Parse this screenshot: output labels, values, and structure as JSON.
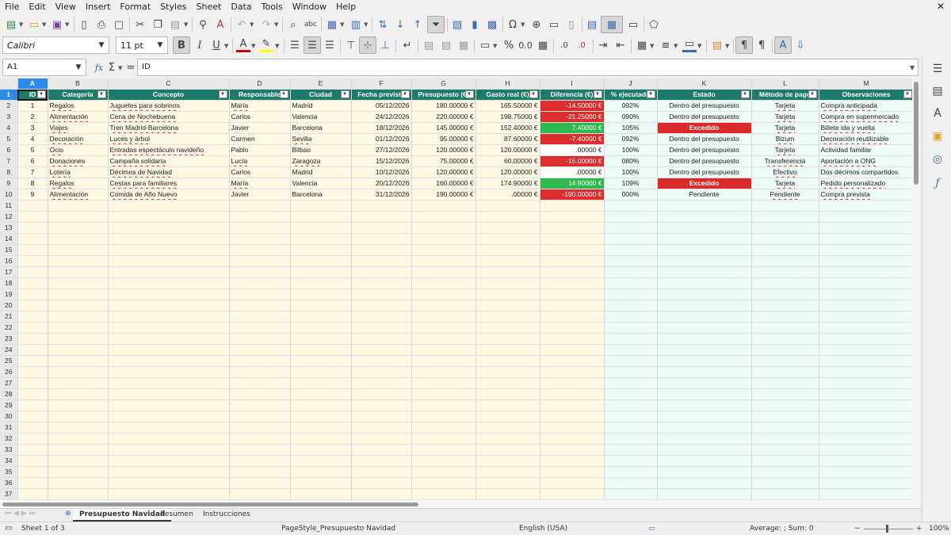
{
  "menu": [
    "File",
    "Edit",
    "View",
    "Insert",
    "Format",
    "Styles",
    "Sheet",
    "Data",
    "Tools",
    "Window",
    "Help"
  ],
  "font": {
    "name": "Calibri",
    "size": "11 pt"
  },
  "formula_bar": {
    "cell_ref": "A1",
    "content": "ID",
    "fx": "fx",
    "sigma": "Σ",
    "equals": "="
  },
  "columns": [
    "A",
    "B",
    "C",
    "D",
    "E",
    "F",
    "G",
    "H",
    "I",
    "J",
    "K",
    "L",
    "M"
  ],
  "headers": [
    "ID",
    "Categoría",
    "Concepto",
    "Responsable",
    "Ciudad",
    "Fecha prevista",
    "Presupuesto (€)",
    "Gasto real (€)",
    "Diferencia (€)",
    "% ejecutado",
    "Estado",
    "Método de pago",
    "Observaciones"
  ],
  "rows": [
    {
      "id": "1",
      "categoria": "Regalos",
      "concepto": "Juguetes para sobrinos",
      "responsable": "María",
      "ciudad": "Madrid",
      "fecha": "05/12/2026",
      "presupuesto": "180.00000 €",
      "gasto": "165.50000 €",
      "diferencia": "-14.50000 €",
      "diff_status": "red",
      "pct": "092%",
      "estado": "Dentro del presupuesto",
      "estado_status": "ok",
      "metodo": "Tarjeta",
      "observaciones": "Compra anticipada"
    },
    {
      "id": "2",
      "categoria": "Alimentación",
      "concepto": "Cena de Nochebuena",
      "responsable": "Carlos",
      "ciudad": "Valencia",
      "fecha": "24/12/2026",
      "presupuesto": "220.00000 €",
      "gasto": "198.75000 €",
      "diferencia": "-21.25000 €",
      "diff_status": "red",
      "pct": "090%",
      "estado": "Dentro del presupuesto",
      "estado_status": "ok",
      "metodo": "Tarjeta",
      "observaciones": "Compra en supermercado"
    },
    {
      "id": "3",
      "categoria": "Viajes",
      "concepto": "Tren Madrid-Barcelona",
      "responsable": "Javier",
      "ciudad": "Barcelona",
      "fecha": "18/12/2026",
      "presupuesto": "145.00000 €",
      "gasto": "152.40000 €",
      "diferencia": "7.40000 €",
      "diff_status": "green",
      "pct": "105%",
      "estado": "Excedido",
      "estado_status": "over",
      "metodo": "Tarjeta",
      "observaciones": "Billete ida y vuelta"
    },
    {
      "id": "4",
      "categoria": "Decoración",
      "concepto": "Luces y árbol",
      "responsable": "Carmen",
      "ciudad": "Sevilla",
      "fecha": "01/12/2026",
      "presupuesto": "95.00000 €",
      "gasto": "87.60000 €",
      "diferencia": "-7.40000 €",
      "diff_status": "red",
      "pct": "092%",
      "estado": "Dentro del presupuesto",
      "estado_status": "ok",
      "metodo": "Bizum",
      "observaciones": "Decoración reutilizable"
    },
    {
      "id": "5",
      "categoria": "Ocio",
      "concepto": "Entradas espectáculo navideño",
      "responsable": "Pablo",
      "ciudad": "Bilbao",
      "fecha": "27/12/2026",
      "presupuesto": "120.00000 €",
      "gasto": "120.00000 €",
      "diferencia": ".00000 €",
      "diff_status": "none",
      "pct": "100%",
      "estado": "Dentro del presupuesto",
      "estado_status": "ok",
      "metodo": "Tarjeta",
      "observaciones": "Actividad familiar"
    },
    {
      "id": "6",
      "categoria": "Donaciones",
      "concepto": "Campaña solidaria",
      "responsable": "Lucía",
      "ciudad": "Zaragoza",
      "fecha": "15/12/2026",
      "presupuesto": "75.00000 €",
      "gasto": "60.00000 €",
      "diferencia": "-15.00000 €",
      "diff_status": "red",
      "pct": "080%",
      "estado": "Dentro del presupuesto",
      "estado_status": "ok",
      "metodo": "Transferencia",
      "observaciones": "Aportación a ONG"
    },
    {
      "id": "7",
      "categoria": "Lotería",
      "concepto": "Décimos de Navidad",
      "responsable": "Carlos",
      "ciudad": "Madrid",
      "fecha": "10/12/2026",
      "presupuesto": "120.00000 €",
      "gasto": "120.00000 €",
      "diferencia": ".00000 €",
      "diff_status": "none",
      "pct": "100%",
      "estado": "Dentro del presupuesto",
      "estado_status": "ok",
      "metodo": "Efectivo",
      "observaciones": "Dos décimos compartidos"
    },
    {
      "id": "8",
      "categoria": "Regalos",
      "concepto": "Cestas para familiares",
      "responsable": "María",
      "ciudad": "Valencia",
      "fecha": "20/12/2026",
      "presupuesto": "160.00000 €",
      "gasto": "174.90000 €",
      "diferencia": "14.90000 €",
      "diff_status": "green",
      "pct": "109%",
      "estado": "Excedido",
      "estado_status": "over",
      "metodo": "Tarjeta",
      "observaciones": "Pedido personalizado"
    },
    {
      "id": "9",
      "categoria": "Alimentación",
      "concepto": "Comida de Año Nuevo",
      "responsable": "Javier",
      "ciudad": "Barcelona",
      "fecha": "31/12/2026",
      "presupuesto": "190.00000 €",
      "gasto": ".00000 €",
      "diferencia": "-190.00000 €",
      "diff_status": "red",
      "pct": "000%",
      "estado": "Pendiente",
      "estado_status": "pending",
      "metodo": "Pendiente",
      "observaciones": "Compra prevista"
    }
  ],
  "empty_row_numbers": [
    "11",
    "12",
    "13",
    "14",
    "15",
    "16",
    "17",
    "18",
    "19",
    "20",
    "21",
    "22",
    "23",
    "24",
    "25",
    "26",
    "27",
    "28",
    "29",
    "30",
    "31",
    "32",
    "33",
    "34",
    "35",
    "36",
    "37"
  ],
  "colors": {
    "header_bg": "#1e7a6b",
    "diff_red": "#dc2e2e",
    "diff_green": "#2fb84f",
    "excedido": "#dc2a2a",
    "cell_yellow": "#fdf8e4",
    "cell_teal": "#eefaf6",
    "selection": "#2b8ae8"
  },
  "tabs": [
    "Presupuesto Navidad",
    "Resumen",
    "Instrucciones"
  ],
  "status": {
    "sheet": "Sheet 1 of 3",
    "page_style": "PageStyle_Presupuesto Navidad",
    "language": "English (USA)",
    "summary": "Average: ; Sum: 0",
    "zoom": "100%"
  },
  "icons": {
    "toolbar1": [
      "new-icon",
      "open-icon",
      "save-icon",
      "export-pdf-icon",
      "print-icon",
      "print-preview-icon",
      "cut-icon",
      "copy-icon",
      "paste-icon",
      "clone-format-icon",
      "clear-format-icon",
      "undo-icon",
      "redo-icon",
      "find-replace-icon",
      "spellcheck-icon",
      "row-icon",
      "column-icon",
      "sort-icon",
      "sort-ascending-icon",
      "sort-descending-icon",
      "autofilter-icon",
      "image-icon",
      "chart-icon",
      "pivot-table-icon",
      "special-char-icon",
      "hyperlink-icon",
      "comment-icon",
      "header-footer-icon",
      "define-print-area-icon",
      "freeze-rows-icon",
      "split-window-icon",
      "show-draw-functions-icon"
    ],
    "toolbar2": [
      "bold-icon",
      "italic-icon",
      "underline-icon",
      "font-color-icon",
      "highlight-icon",
      "align-left-icon",
      "align-center-icon",
      "align-right-icon",
      "align-top-icon",
      "align-middle-icon",
      "align-bottom-icon",
      "wrap-text-icon",
      "merge-center-icon",
      "merge-cells-icon",
      "unmerge-cells-icon",
      "currency-icon",
      "percent-icon",
      "number-format-icon",
      "date-icon",
      "add-decimal-icon",
      "delete-decimal-icon",
      "increase-indent-icon",
      "decrease-indent-icon",
      "borders-icon",
      "border-style-icon",
      "border-color-icon",
      "conditional-format-icon",
      "ltr-icon",
      "rtl-icon",
      "text-direction-icon",
      "vertical-text-icon"
    ],
    "sidebar": [
      "hamburger-icon",
      "properties-icon",
      "styles-icon",
      "gallery-icon",
      "navigator-icon",
      "functions-icon"
    ]
  }
}
